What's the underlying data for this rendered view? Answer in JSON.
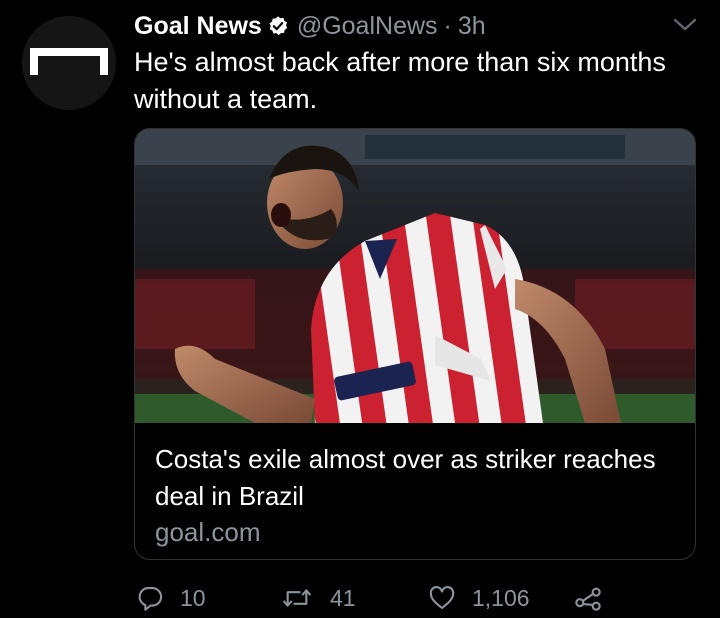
{
  "tweet": {
    "author_name": "Goal News",
    "handle": "@GoalNews",
    "separator": "·",
    "time": "3h",
    "text": "He's almost back after more than six months without a team.",
    "avatar_icon": "goal-logo-icon",
    "verified_icon": "verified-badge-icon",
    "menu_icon": "chevron-down-icon"
  },
  "card": {
    "image_alt": "Footballer in red and white striped kit celebrating with clenched fist",
    "title": "Costa's exile almost over as striker reaches deal in Brazil",
    "domain": "goal.com"
  },
  "actions": {
    "reply_count": "10",
    "retweet_count": "41",
    "like_count": "1,106",
    "reply_icon": "reply-icon",
    "retweet_icon": "retweet-icon",
    "like_icon": "heart-icon",
    "share_icon": "share-icon"
  },
  "colors": {
    "background": "#000000",
    "text_primary": "#ffffff",
    "text_secondary": "#8b959e",
    "card_border": "#2f3336"
  }
}
